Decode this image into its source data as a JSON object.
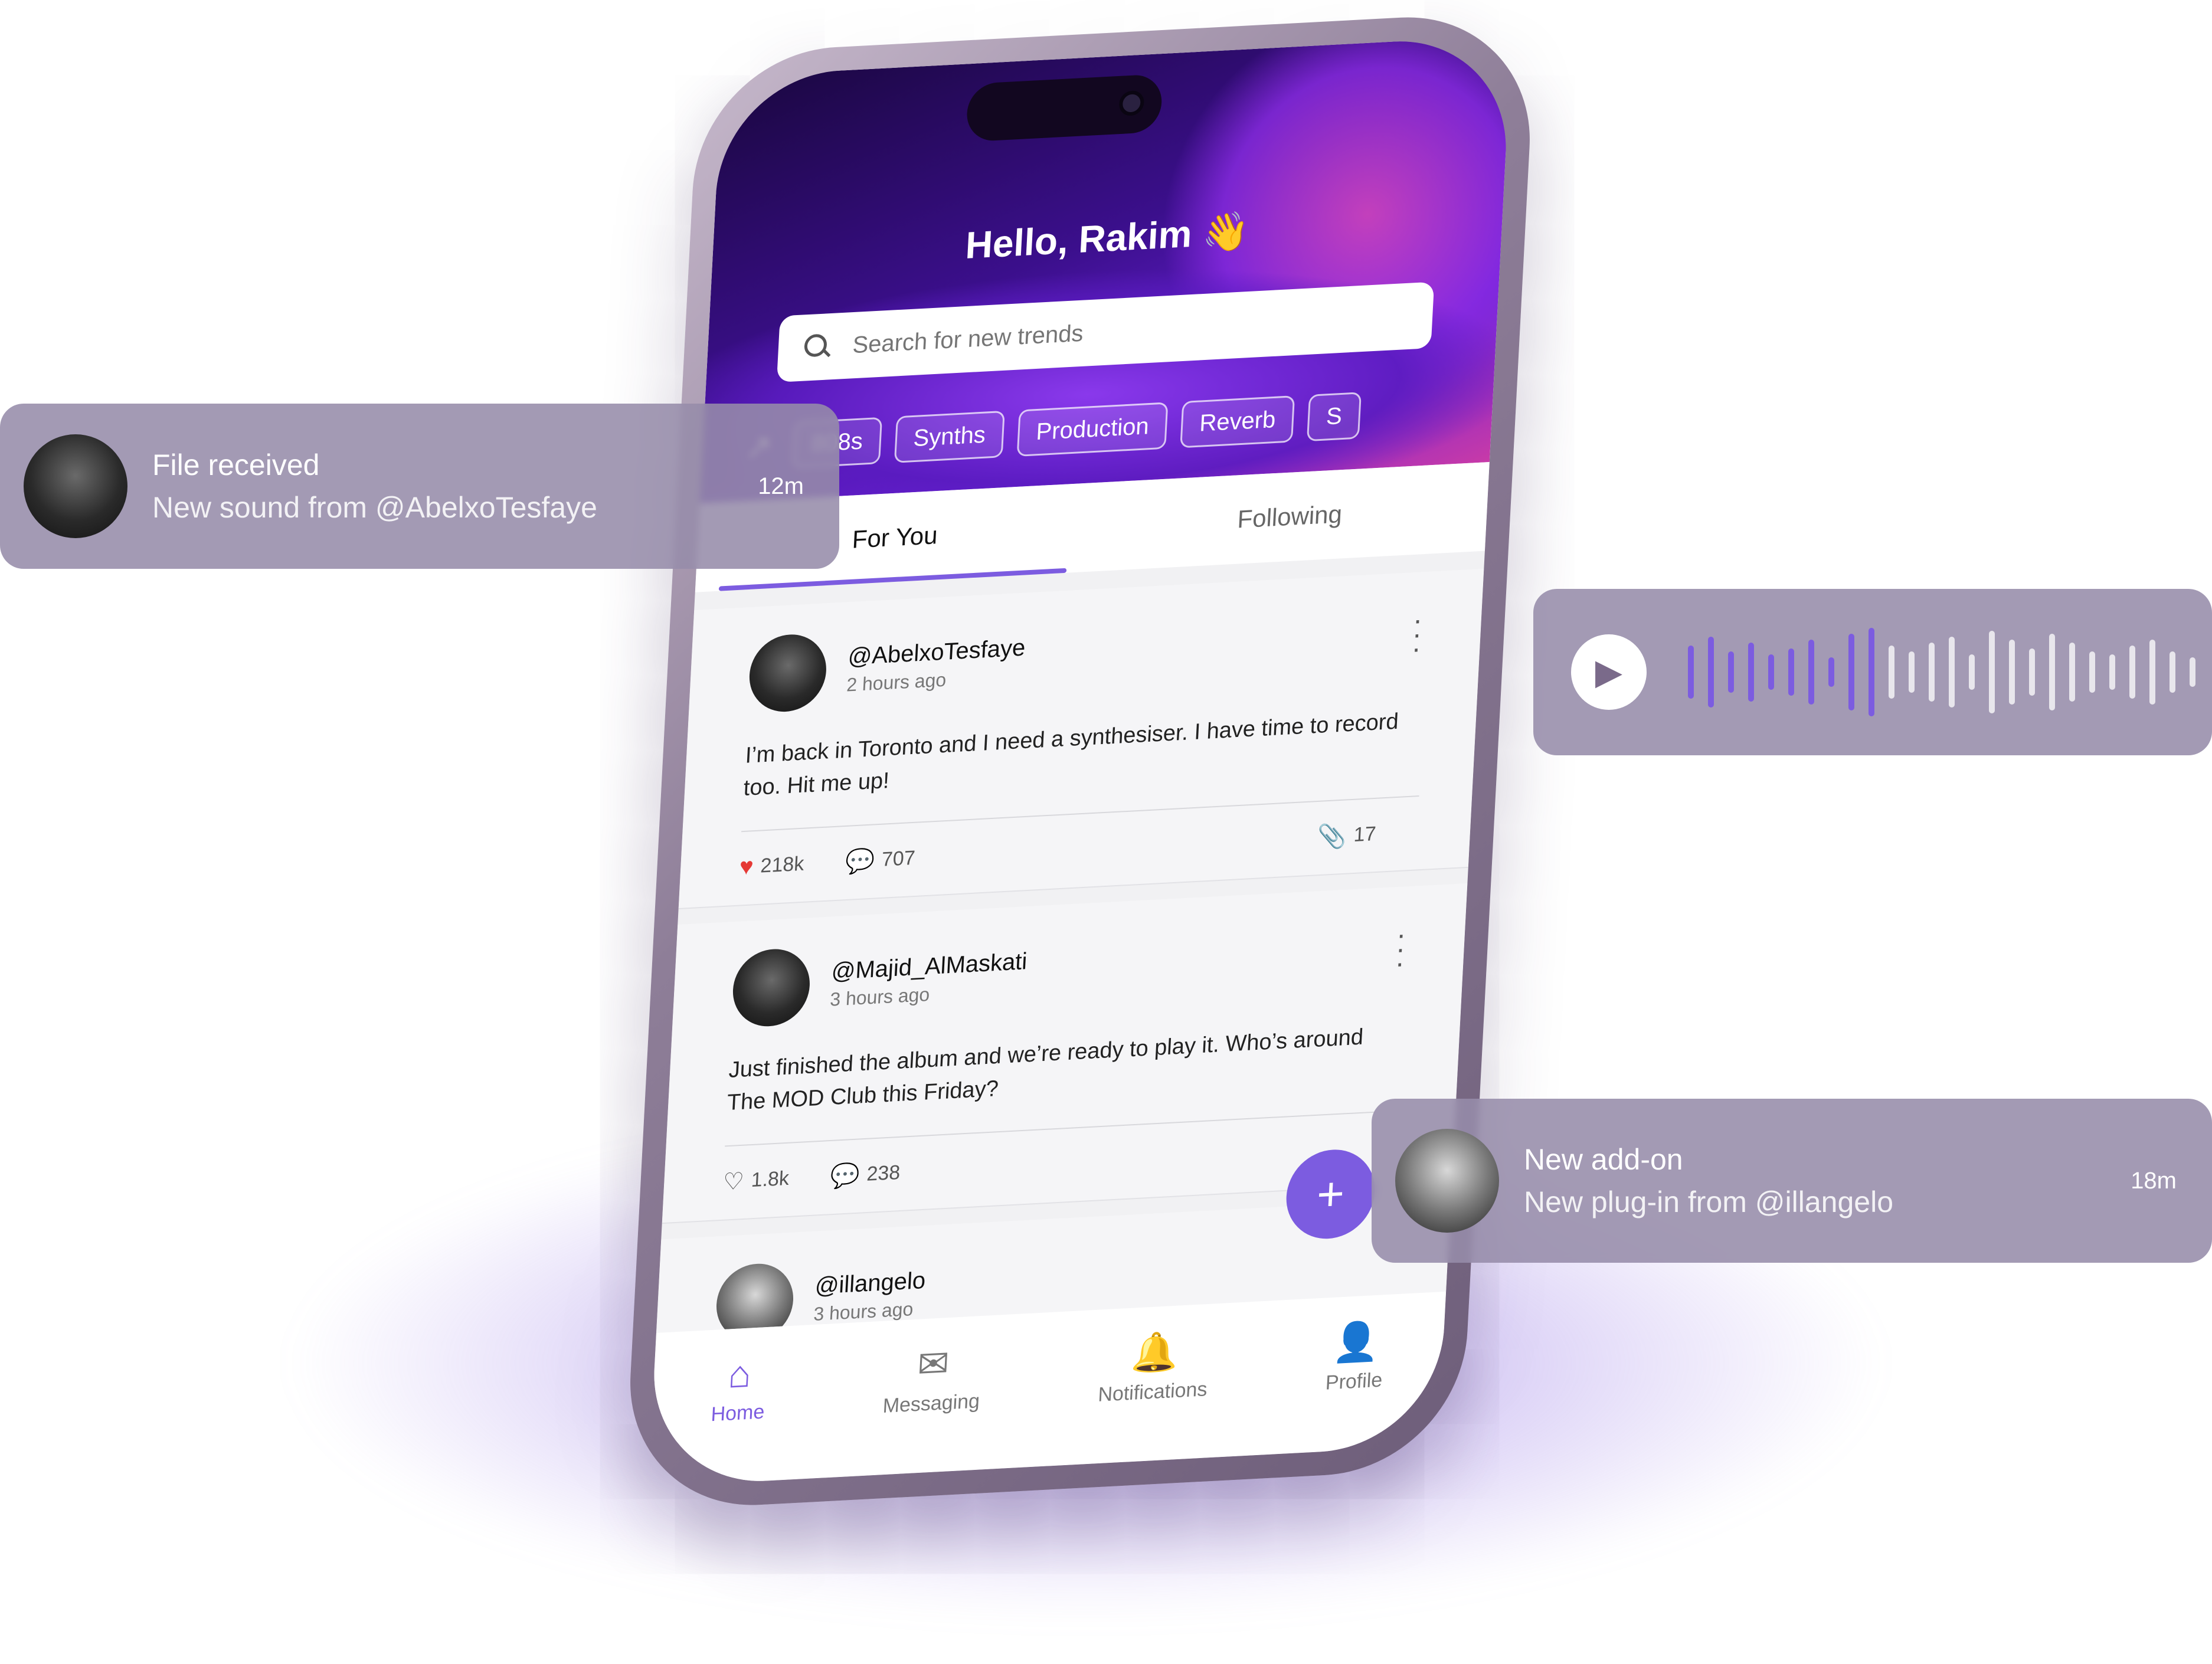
{
  "app": {
    "greeting": "Hello, Rakim 👋",
    "search_placeholder": "Search for new trends",
    "trending_icon": "trending-up-icon",
    "chips": [
      "808s",
      "Synths",
      "Production",
      "Reverb",
      "S"
    ],
    "tabs": [
      "For You",
      "Following"
    ],
    "active_tab": "For You",
    "posts": [
      {
        "handle": "@AbelxoTesfaye",
        "time": "2 hours ago",
        "body": "I’m back in Toronto and I need a synthesiser. I have time to record too. Hit me up!",
        "likes": "218k",
        "liked": true,
        "comments": "707",
        "attachments": "17"
      },
      {
        "handle": "@Majid_AlMaskati",
        "time": "3 hours ago",
        "body": "Just finished the album and we’re ready to play it. Who’s around The MOD Club this Friday?",
        "likes": "1.8k",
        "liked": false,
        "comments": "238",
        "attachments": ""
      },
      {
        "handle": "@illangelo",
        "time": "3 hours ago",
        "body": "",
        "likes": "",
        "liked": false,
        "comments": "",
        "attachments": ""
      }
    ],
    "nav": [
      {
        "label": "Home",
        "icon": "home-icon",
        "active": true
      },
      {
        "label": "Messaging",
        "icon": "messaging-icon",
        "active": false
      },
      {
        "label": "Notifications",
        "icon": "bell-icon",
        "active": false
      },
      {
        "label": "Profile",
        "icon": "profile-icon",
        "active": false
      }
    ],
    "fab_icon": "plus-icon"
  },
  "notifications": [
    {
      "title": "File received",
      "subtitle": "New sound from @AbelxoTesfaye",
      "time": "12m"
    },
    {
      "title": "New add-on",
      "subtitle": "New plug-in from @illangelo",
      "time": "18m"
    }
  ],
  "audio_player": {
    "play_icon": "play-icon",
    "waveform_played_fraction": 0.38
  },
  "colors": {
    "accent": "#7c5ce0",
    "like_red": "#e53935",
    "hero_dark": "#1a0740",
    "hero_pink": "#c83aa8"
  }
}
